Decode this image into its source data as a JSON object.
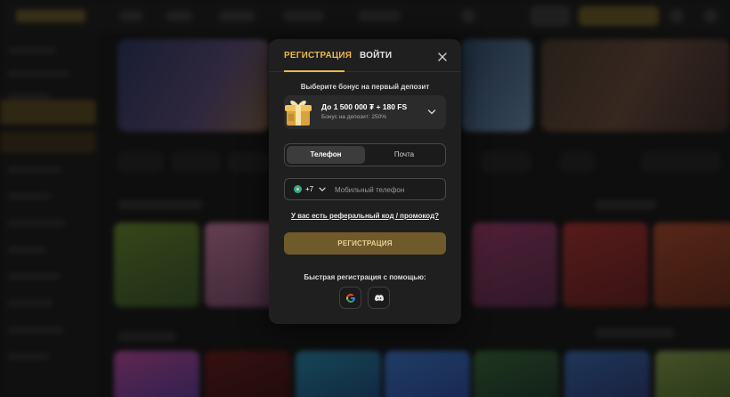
{
  "modal": {
    "tabs": [
      {
        "label": "РЕГИСТРАЦИЯ",
        "active": true
      },
      {
        "label": "ВОЙТИ",
        "active": false
      }
    ],
    "close_icon": "close-icon",
    "bonus": {
      "caption": "Выберите бонус на первый депозит",
      "selected_title": "До 1 500 000 ₮ + 180 FS",
      "selected_subtitle": "Бонус на депозит: 250%",
      "icon": "gift-box-icon"
    },
    "method_toggle": {
      "options": [
        "Телефон",
        "Почта"
      ],
      "selected": "Телефон"
    },
    "phone": {
      "country_code": "+7",
      "placeholder": "Мобильный телефон",
      "value": ""
    },
    "promo_link": "У вас есть реферальный код / промокод?",
    "submit_label": "РЕГИСТРАЦИЯ",
    "quick_reg_caption": "Быстрая регистрация с помощью:",
    "social": [
      {
        "name": "google",
        "icon": "google-icon"
      },
      {
        "name": "discord",
        "icon": "discord-icon"
      }
    ]
  },
  "colors": {
    "accent": "#e9b949",
    "submit_bg": "#6f5a2c",
    "modal_bg": "#1f1f1f",
    "page_bg": "#151515"
  }
}
